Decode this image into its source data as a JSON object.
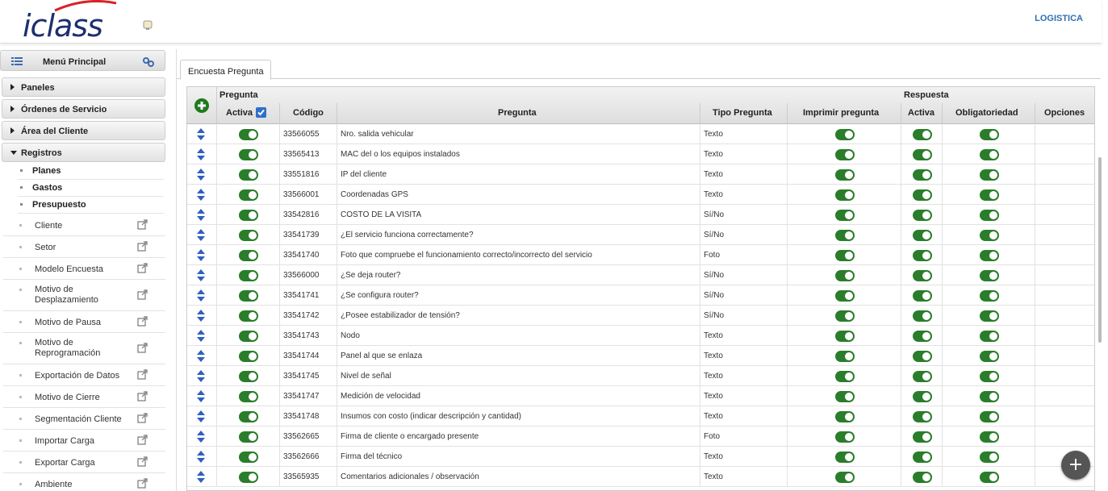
{
  "brand": {
    "logo_text": "iclass",
    "colors": {
      "accent": "#1d2f6e",
      "toggle_on": "#2a7d2a",
      "link": "#2f6fb0"
    }
  },
  "header": {
    "user_label": "LOGISTICA"
  },
  "sidebar": {
    "menu_title": "Menú Principal",
    "sections": [
      {
        "label": "Paneles",
        "expanded": false
      },
      {
        "label": "Órdenes de Servicio",
        "expanded": false
      },
      {
        "label": "Área del Cliente",
        "expanded": false
      },
      {
        "label": "Registros",
        "expanded": true
      }
    ],
    "subsections": [
      "Planes",
      "Gastos",
      "Presupuesto"
    ],
    "items": [
      {
        "line1": "Cliente",
        "line2": ""
      },
      {
        "line1": "Setor",
        "line2": ""
      },
      {
        "line1": "Modelo Encuesta",
        "line2": ""
      },
      {
        "line1": "Motivo de",
        "line2": "Desplazamiento"
      },
      {
        "line1": "Motivo de Pausa",
        "line2": ""
      },
      {
        "line1": "Motivo de",
        "line2": "Reprogramación"
      },
      {
        "line1": "Exportación de Datos",
        "line2": ""
      },
      {
        "line1": "Motivo de Cierre",
        "line2": ""
      },
      {
        "line1": "Segmentación Cliente",
        "line2": ""
      },
      {
        "line1": "Importar Carga",
        "line2": ""
      },
      {
        "line1": "Exportar Carga",
        "line2": ""
      },
      {
        "line1": "Ambiente",
        "line2": ""
      }
    ]
  },
  "content": {
    "tab_label": "Encuesta Pregunta",
    "table": {
      "group_pregunta": "Pregunta",
      "group_respuesta": "Respuesta",
      "headers": {
        "activa": "Activa",
        "codigo": "Código",
        "pregunta": "Pregunta",
        "tipo": "Tipo Pregunta",
        "imprimir": "Imprimir pregunta",
        "resp_activa": "Activa",
        "obligatoriedad": "Obligatoriedad",
        "opciones": "Opciones"
      },
      "rows": [
        {
          "codigo": "33566055",
          "pregunta": "Nro. salida vehicular",
          "tipo": "Texto"
        },
        {
          "codigo": "33565413",
          "pregunta": "MAC del o los equipos instalados",
          "tipo": "Texto"
        },
        {
          "codigo": "33551816",
          "pregunta": "IP del cliente",
          "tipo": "Texto"
        },
        {
          "codigo": "33566001",
          "pregunta": "Coordenadas GPS",
          "tipo": "Texto"
        },
        {
          "codigo": "33542816",
          "pregunta": "COSTO DE LA VISITA",
          "tipo": "Sí/No"
        },
        {
          "codigo": "33541739",
          "pregunta": "¿El servicio funciona correctamente?",
          "tipo": "Sí/No"
        },
        {
          "codigo": "33541740",
          "pregunta": "Foto que compruebe el funcionamiento correcto/incorrecto del servicio",
          "tipo": "Foto"
        },
        {
          "codigo": "33566000",
          "pregunta": "¿Se deja router?",
          "tipo": "Sí/No"
        },
        {
          "codigo": "33541741",
          "pregunta": "¿Se configura router?",
          "tipo": "Sí/No"
        },
        {
          "codigo": "33541742",
          "pregunta": "¿Posee estabilizador de tensión?",
          "tipo": "Sí/No"
        },
        {
          "codigo": "33541743",
          "pregunta": "Nodo",
          "tipo": "Texto"
        },
        {
          "codigo": "33541744",
          "pregunta": "Panel al que se enlaza",
          "tipo": "Texto"
        },
        {
          "codigo": "33541745",
          "pregunta": "Nivel de señal",
          "tipo": "Texto"
        },
        {
          "codigo": "33541747",
          "pregunta": "Medición de velocidad",
          "tipo": "Texto"
        },
        {
          "codigo": "33541748",
          "pregunta": "Insumos con costo (indicar descripción y cantidad)",
          "tipo": "Texto"
        },
        {
          "codigo": "33562665",
          "pregunta": "Firma de cliente o encargado presente",
          "tipo": "Foto"
        },
        {
          "codigo": "33562666",
          "pregunta": "Firma del técnico",
          "tipo": "Texto"
        },
        {
          "codigo": "33565935",
          "pregunta": "Comentarios adicionales / observación",
          "tipo": "Texto"
        }
      ]
    }
  }
}
